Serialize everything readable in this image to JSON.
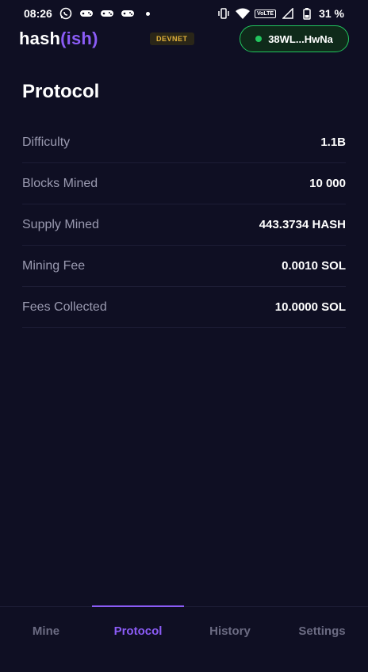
{
  "status_bar": {
    "time": "08:26",
    "battery": "31 %",
    "network_label": "VoLTE",
    "left_icons": [
      "whatsapp-icon",
      "game-controller-icon",
      "game-controller-icon",
      "game-controller-icon",
      "notification-dot"
    ],
    "right_icons": [
      "vibrate-icon",
      "wifi-icon",
      "volte-icon",
      "signal-icon",
      "battery-icon"
    ]
  },
  "header": {
    "logo_main": "hash",
    "logo_accent": "(ish)",
    "network_badge": "DEVNET",
    "wallet_label": "38WL...HwNa"
  },
  "page": {
    "title": "Protocol",
    "stats": [
      {
        "label": "Difficulty",
        "value": "1.1B"
      },
      {
        "label": "Blocks Mined",
        "value": "10 000"
      },
      {
        "label": "Supply Mined",
        "value": "443.3734 HASH"
      },
      {
        "label": "Mining Fee",
        "value": "0.0010 SOL"
      },
      {
        "label": "Fees Collected",
        "value": "10.0000 SOL"
      }
    ]
  },
  "nav": {
    "tabs": [
      {
        "label": "Mine"
      },
      {
        "label": "Protocol"
      },
      {
        "label": "History"
      },
      {
        "label": "Settings"
      }
    ],
    "active": "Protocol"
  },
  "colors": {
    "background": "#0f0f23",
    "accent": "#8b5cf6",
    "wallet_green": "#22c55e",
    "devnet_badge": "#e2b23a",
    "muted_text": "#9a9ab0"
  }
}
